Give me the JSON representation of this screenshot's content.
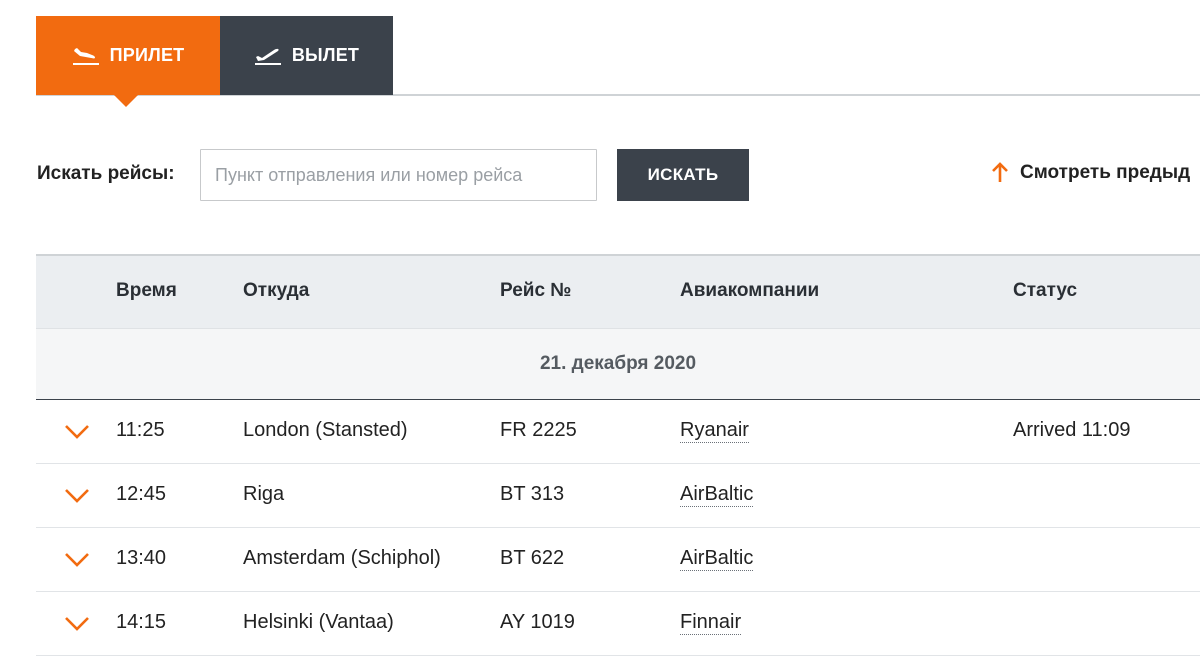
{
  "tabs": {
    "arrivals": {
      "label": "ПРИЛЕТ",
      "icon": "plane-landing-icon",
      "active": true,
      "color": "#f26b10"
    },
    "departures": {
      "label": "ВЫЛЕТ",
      "icon": "plane-takeoff-icon",
      "active": false,
      "color": "#3b424b"
    }
  },
  "search": {
    "label": "Искать рейсы:",
    "placeholder": "Пункт отправления или номер рейса",
    "value": "",
    "button_label": "ИСКАТЬ"
  },
  "previous_link": {
    "label": "Смотреть предыд",
    "icon": "arrow-up-icon",
    "accent": "#f26b10"
  },
  "table": {
    "headers": {
      "time": "Время",
      "from": "Откуда",
      "flight": "Рейс №",
      "airlines": "Авиакомпании",
      "status": "Статус"
    },
    "date": "21. декабря 2020",
    "rows": [
      {
        "time": "11:25",
        "from": "London (Stansted)",
        "flight": "FR 2225",
        "airline": "Ryanair",
        "status": "Arrived 11:09"
      },
      {
        "time": "12:45",
        "from": "Riga",
        "flight": "BT 313",
        "airline": "AirBaltic",
        "status": ""
      },
      {
        "time": "13:40",
        "from": "Amsterdam (Schiphol)",
        "flight": "BT 622",
        "airline": "AirBaltic",
        "status": ""
      },
      {
        "time": "14:15",
        "from": "Helsinki (Vantaa)",
        "flight": "AY 1019",
        "airline": "Finnair",
        "status": ""
      }
    ]
  }
}
